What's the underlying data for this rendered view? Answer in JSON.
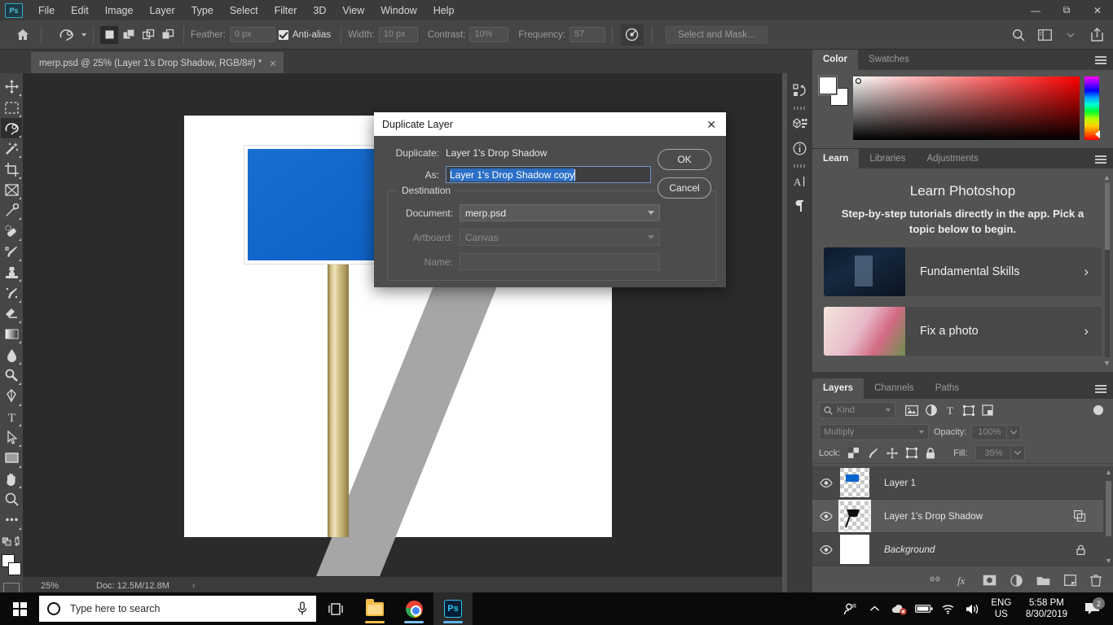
{
  "menubar": {
    "app_icon": "photoshop-logo",
    "items": [
      "File",
      "Edit",
      "Image",
      "Layer",
      "Type",
      "Select",
      "Filter",
      "3D",
      "View",
      "Window",
      "Help"
    ],
    "window_controls": [
      "minimize",
      "restore",
      "close"
    ]
  },
  "options_bar": {
    "home_icon": "home-icon",
    "tool_preset": "lasso-tool-preset",
    "selection_modes": [
      "new-selection",
      "add-to-selection",
      "subtract-from-selection",
      "intersect-selection"
    ],
    "feather_label": "Feather:",
    "feather_value": "0 px",
    "antialias_label": "Anti-alias",
    "antialias_checked": true,
    "width_label": "Width:",
    "width_value": "10 px",
    "contrast_label": "Contrast:",
    "contrast_value": "10%",
    "frequency_label": "Frequency:",
    "frequency_value": "57",
    "select_and_mask_label": "Select and Mask...",
    "right_icons": [
      "search-icon",
      "workspace-icon",
      "share-icon"
    ]
  },
  "document_tab": {
    "label": "merp.psd @ 25% (Layer 1's Drop Shadow, RGB/8#) *",
    "close_icon": "close-icon"
  },
  "toolbar": {
    "tools": [
      {
        "name": "move-tool"
      },
      {
        "name": "rectangular-marquee-tool"
      },
      {
        "name": "lasso-tool",
        "selected": true
      },
      {
        "name": "magic-wand-tool"
      },
      {
        "name": "crop-tool"
      },
      {
        "name": "frame-tool"
      },
      {
        "name": "eyedropper-tool"
      },
      {
        "name": "spot-healing-brush-tool"
      },
      {
        "name": "brush-tool"
      },
      {
        "name": "clone-stamp-tool"
      },
      {
        "name": "history-brush-tool"
      },
      {
        "name": "eraser-tool"
      },
      {
        "name": "gradient-tool"
      },
      {
        "name": "blur-tool"
      },
      {
        "name": "dodge-tool"
      },
      {
        "name": "pen-tool"
      },
      {
        "name": "type-tool"
      },
      {
        "name": "path-selection-tool"
      },
      {
        "name": "rectangle-tool"
      },
      {
        "name": "hand-tool"
      },
      {
        "name": "zoom-tool"
      },
      {
        "name": "edit-toolbar-tool"
      }
    ],
    "foreground_color": "#ffffff",
    "background_color": "#ffffff"
  },
  "canvas": {
    "zoom": "25%",
    "artboard_background": "#ffffff",
    "sign_color": "#0b65ce",
    "shadow_color": "#a6a6a6",
    "post_color": "#d8c88c"
  },
  "status_bar": {
    "zoom_value": "25%",
    "doc_label": "Doc: 12.5M/12.8M",
    "arrow_icon": "chevron-right-icon"
  },
  "icon_rail": {
    "items": [
      "history-icon",
      "3d-icon",
      "info-icon",
      "character-icon",
      "paragraph-icon"
    ]
  },
  "color_panel": {
    "tabs": [
      {
        "label": "Color",
        "active": true
      },
      {
        "label": "Swatches",
        "active": false
      }
    ],
    "menu_icon": "panel-menu-icon",
    "foreground": "#ffffff",
    "background": "#ffffff"
  },
  "learn_panel": {
    "tabs": [
      {
        "label": "Learn",
        "active": true
      },
      {
        "label": "Libraries",
        "active": false
      },
      {
        "label": "Adjustments",
        "active": false
      }
    ],
    "menu_icon": "panel-menu-icon",
    "title": "Learn Photoshop",
    "subtitle": "Step-by-step tutorials directly in the app. Pick a topic below to begin.",
    "cards": [
      {
        "label": "Fundamental Skills",
        "chevron": "chevron-right-icon"
      },
      {
        "label": "Fix a photo",
        "chevron": "chevron-right-icon"
      }
    ]
  },
  "layers_panel": {
    "tabs": [
      {
        "label": "Layers",
        "active": true
      },
      {
        "label": "Channels",
        "active": false
      },
      {
        "label": "Paths",
        "active": false
      }
    ],
    "menu_icon": "panel-menu-icon",
    "filter_placeholder": "Kind",
    "filter_icons": [
      "pixel-filter-icon",
      "adjustment-filter-icon",
      "type-filter-icon",
      "shape-filter-icon",
      "smart-object-filter-icon"
    ],
    "blend_mode": "Multiply",
    "opacity_label": "Opacity:",
    "opacity_value": "100%",
    "lock_label": "Lock:",
    "lock_icons": [
      "lock-transparency-icon",
      "lock-image-icon",
      "lock-position-icon",
      "lock-artboard-icon",
      "lock-all-icon"
    ],
    "fill_label": "Fill:",
    "fill_value": "35%",
    "rows": [
      {
        "name": "Layer 1",
        "visible": true,
        "selected": false,
        "italic": false,
        "badge": null
      },
      {
        "name": "Layer 1's Drop Shadow",
        "visible": true,
        "selected": true,
        "italic": false,
        "badge": "smart-object-badge-icon"
      },
      {
        "name": "Background",
        "visible": true,
        "selected": false,
        "italic": true,
        "badge": "lock-icon"
      }
    ],
    "footer_icons": [
      "link-layers-icon",
      "layer-style-icon",
      "layer-mask-icon",
      "adjustment-layer-icon",
      "new-group-icon",
      "new-layer-icon",
      "delete-layer-icon"
    ]
  },
  "dialog": {
    "title": "Duplicate Layer",
    "close_icon": "close-icon",
    "duplicate_label": "Duplicate:",
    "duplicate_value": "Layer 1's Drop Shadow",
    "as_label": "As:",
    "as_value": "Layer 1's Drop Shadow copy",
    "destination_legend": "Destination",
    "document_label": "Document:",
    "document_value": "merp.psd",
    "artboard_label": "Artboard:",
    "artboard_value": "Canvas",
    "name_label": "Name:",
    "name_value": "",
    "ok_label": "OK",
    "cancel_label": "Cancel"
  },
  "taskbar": {
    "start_icon": "windows-start-icon",
    "search_placeholder": "Type here to search",
    "cortana_icon": "cortana-circle-icon",
    "mic_icon": "microphone-icon",
    "task_view_icon": "task-view-icon",
    "apps": [
      {
        "name": "file-explorer-icon",
        "active": false
      },
      {
        "name": "google-chrome-icon",
        "active": false
      },
      {
        "name": "photoshop-icon",
        "active": true
      }
    ],
    "tray": {
      "people_icon": "people-icon",
      "show_hidden_icon": "chevron-up-icon",
      "onedrive_icon": "onedrive-error-icon",
      "battery_icon": "battery-icon",
      "wifi_icon": "wifi-icon",
      "volume_icon": "volume-icon",
      "language_line1": "ENG",
      "language_line2": "US",
      "time": "5:58 PM",
      "date": "8/30/2019",
      "notifications_icon": "action-center-icon",
      "notifications_count": "2"
    }
  }
}
